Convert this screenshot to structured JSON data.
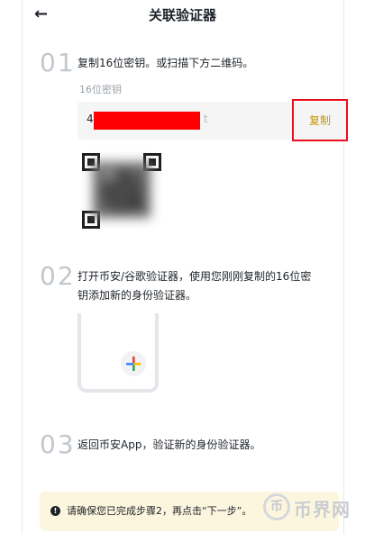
{
  "header": {
    "back_icon": "←",
    "title": "关联验证器"
  },
  "steps": [
    {
      "num": "01",
      "text": "复制16位密钥。或扫描下方二维码。"
    },
    {
      "num": "02",
      "text_line1": "打开币安/谷歌验证器，使用您刚刚复制的16位密",
      "text_line2": "钥添加新的身份验证器。"
    },
    {
      "num": "03",
      "text": "返回币安App，验证新的身份验证器。"
    }
  ],
  "key_field": {
    "label": "16位密钥",
    "prefix": "4",
    "suffix": "t",
    "copy_label": "复制"
  },
  "notice": {
    "icon": "!",
    "text": "请确保您已完成步骤2，再点击“下一步”。"
  },
  "watermark": {
    "logo": "币",
    "text": "币界网"
  },
  "colors": {
    "accent": "#c99400",
    "highlight": "#e8101c",
    "redaction": "#ff0000",
    "notice_bg": "#fdf6df"
  }
}
